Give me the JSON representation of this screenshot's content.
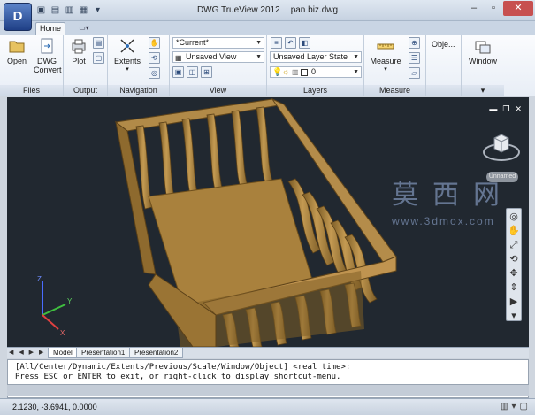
{
  "app": {
    "button_letter": "D",
    "title": "DWG TrueView 2012",
    "filename": "pan biz.dwg"
  },
  "window_controls": {
    "minimize": "–",
    "maximize": "▫",
    "close": "✕"
  },
  "tabs": {
    "home": "Home"
  },
  "ribbon": {
    "files": {
      "title": "Files",
      "open": "Open",
      "dwg_convert_1": "DWG",
      "dwg_convert_2": "Convert"
    },
    "output": {
      "title": "Output",
      "plot": "Plot"
    },
    "navigation": {
      "title": "Navigation",
      "extents": "Extents"
    },
    "view": {
      "title": "View",
      "visual_style": "*Current*",
      "saved_view": "Unsaved View"
    },
    "layers": {
      "title": "Layers",
      "layer_state": "Unsaved Layer State",
      "current_layer": "0"
    },
    "measure": {
      "title": "Measure",
      "measure": "Measure"
    },
    "objects": {
      "label": "Obje..."
    },
    "window": {
      "label": "Window"
    }
  },
  "viewport": {
    "viewcube_label": "Unnamed",
    "watermark_cn": "莫西网",
    "watermark_url": "www.3dmox.com",
    "ucs": {
      "z": "Z",
      "y": "Y",
      "x": "X"
    }
  },
  "layout_tabs": {
    "nav": "◀ ◀ ▶ ▶",
    "model": "Model",
    "pres1": "Présentation1",
    "pres2": "Présentation2"
  },
  "command": {
    "line1": "[All/Center/Dynamic/Extents/Previous/Scale/Window/Object] <real time>:",
    "line2": "Press ESC or ENTER to exit, or right-click to display shortcut-menu."
  },
  "status": {
    "coords": "2.1230, -3.6941, 0.0000"
  },
  "colors": {
    "canvas_bg": "#212830",
    "wood": "#a8823c",
    "wood_dark": "#6b4e1e",
    "wood_light": "#c9a15a"
  }
}
